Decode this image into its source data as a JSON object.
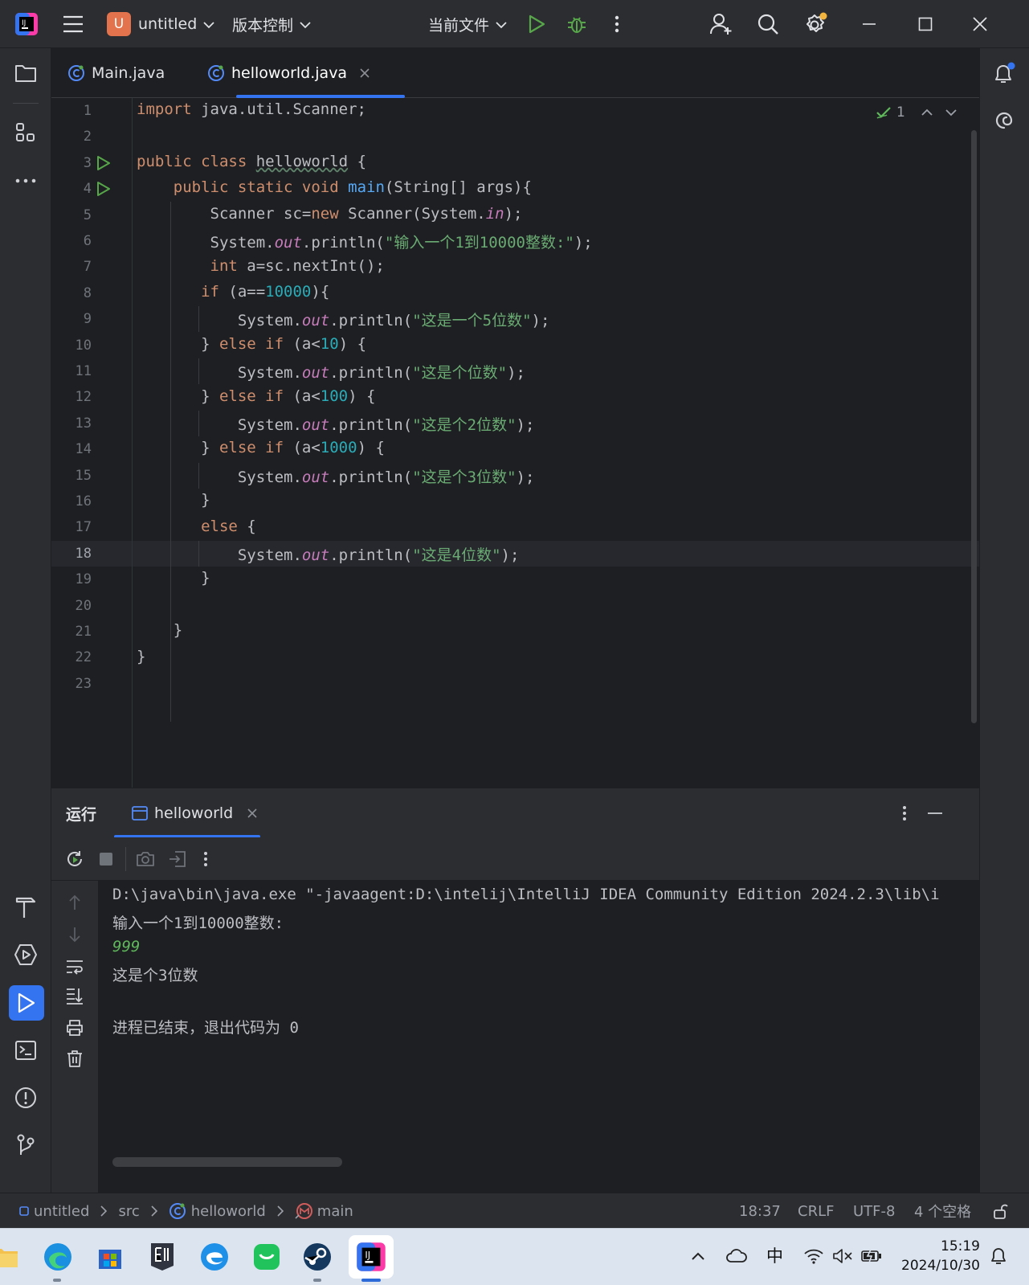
{
  "title_bar": {
    "project_badge": "U",
    "project_name": "untitled",
    "vcs_menu": "版本控制",
    "run_config": "当前文件"
  },
  "tabs": [
    {
      "label": "Main.java",
      "active": false
    },
    {
      "label": "helloworld.java",
      "active": true
    }
  ],
  "editor": {
    "inspection_count": "1",
    "line_numbers": [
      "1",
      "2",
      "3",
      "4",
      "5",
      "6",
      "7",
      "8",
      "9",
      "10",
      "11",
      "12",
      "13",
      "14",
      "15",
      "16",
      "17",
      "18",
      "19",
      "20",
      "21",
      "22",
      "23"
    ],
    "current_line": 18
  },
  "run_panel": {
    "title": "运行",
    "tab_label": "helloworld",
    "console": [
      "D:\\java\\bin\\java.exe \"-javaagent:D:\\intelij\\IntelliJ IDEA Community Edition 2024.2.3\\lib\\i",
      "输入一个1到10000整数:",
      "999",
      "这是个3位数",
      "",
      "进程已结束，退出代码为 0"
    ]
  },
  "status_bar": {
    "breadcrumb": [
      "untitled",
      "src",
      "helloworld",
      "main"
    ],
    "position": "18:37",
    "line_ending": "CRLF",
    "encoding": "UTF-8",
    "indent": "4 个空格"
  },
  "taskbar": {
    "ime": "中",
    "time": "15:19",
    "date": "2024/10/30"
  },
  "colors": {
    "keyword": "#cf8e6d",
    "string": "#6aab73",
    "number": "#2aacb8",
    "field": "#c77dbb",
    "method": "#56a8f5",
    "accent": "#3574f0"
  }
}
